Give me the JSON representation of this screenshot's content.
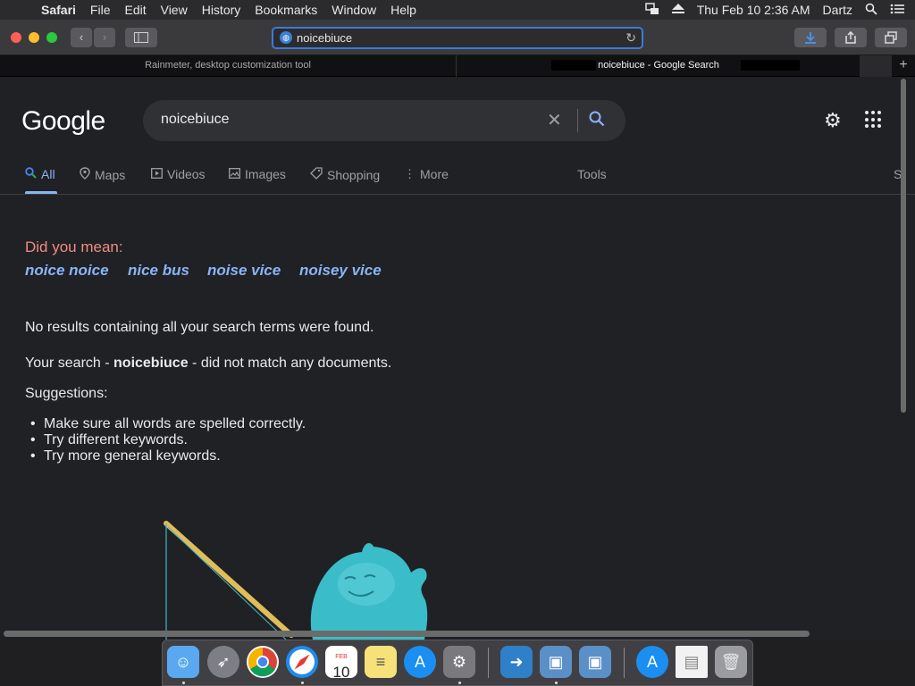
{
  "menubar": {
    "items": [
      "Safari",
      "File",
      "Edit",
      "View",
      "History",
      "Bookmarks",
      "Window",
      "Help"
    ],
    "clock": "Thu Feb 10  2:36 AM",
    "user": "Dartz"
  },
  "toolbar": {
    "url": "noicebiuce"
  },
  "tabs": {
    "tab1_title": "Rainmeter, desktop customization tool",
    "tab2_title": "noicebiuce - Google Search",
    "new_tab_label": "+"
  },
  "google": {
    "logo_text": "Google",
    "query": "noicebiuce",
    "nav": {
      "all": "All",
      "maps": "Maps",
      "videos": "Videos",
      "images": "Images",
      "shopping": "Shopping",
      "more": "More",
      "tools": "Tools",
      "cutoff": "S"
    },
    "did_you_mean_label": "Did you mean:",
    "suggestions": [
      "noice noice",
      "nice bus",
      "noise vice",
      "noisey vice"
    ],
    "no_results": "No results containing all your search terms were found.",
    "search_msg_prefix": "Your search - ",
    "search_msg_term": "noicebiuce",
    "search_msg_suffix": " - did not match any documents.",
    "suggestions_label": "Suggestions:",
    "tips": [
      "Make sure all words are spelled correctly.",
      "Try different keywords.",
      "Try more general keywords."
    ]
  },
  "dock": {
    "apps": [
      "finder-icon",
      "launchpad-icon",
      "chrome-icon",
      "safari-icon",
      "calendar-icon",
      "notes-icon",
      "app-store-icon",
      "system-preferences-icon",
      "migration-assistant-icon",
      "virtualbox-icon",
      "virtualbox-vm-icon",
      "app-store-downloads-icon",
      "document-icon",
      "trash-icon"
    ],
    "calendar_month": "FEB",
    "calendar_day": "10"
  },
  "colors": {
    "accent_blue": "#8ab4f8",
    "did_you_mean_red": "#f28b82",
    "address_focus": "#3d7bd6",
    "page_bg": "#202124"
  }
}
